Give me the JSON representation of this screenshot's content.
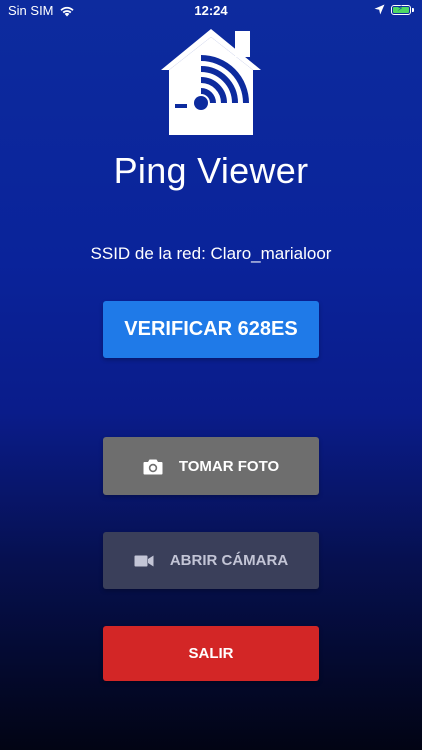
{
  "status_bar": {
    "carrier": "Sin SIM",
    "time": "12:24",
    "battery_color": "#4cd964"
  },
  "logo": {
    "icon": "home-wifi-icon"
  },
  "app": {
    "title": "Ping Viewer"
  },
  "network": {
    "ssid_text": "SSID de la red: Claro_marialoor"
  },
  "buttons": {
    "verify_label": "VERIFICAR 628ES",
    "photo_label": "TOMAR FOTO",
    "camera_label": "ABRIR CÁMARA",
    "exit_label": "SALIR"
  },
  "colors": {
    "verify": "#1f7ae8",
    "photo": "#6e6e6e",
    "camera": "#3a3f5a",
    "exit": "#d32626"
  }
}
